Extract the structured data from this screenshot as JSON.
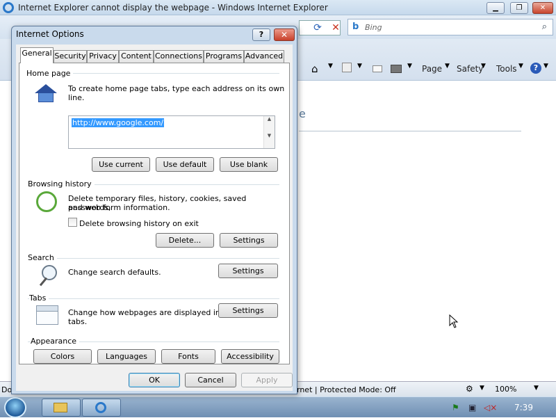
{
  "ie": {
    "title": "Internet Explorer cannot display the webpage - Windows Internet Explorer",
    "window_buttons": {
      "minimize": "▁",
      "maximize": "❐",
      "close": "✕"
    },
    "search_placeholder": "Bing",
    "commands": [
      "Page",
      "Safety",
      "Tools"
    ],
    "error_fragment": "e",
    "status_left": "Do",
    "status_text": "rnet | Protected Mode: Off",
    "zoom": "100%"
  },
  "taskbar": {
    "clock": "7:39"
  },
  "dialog": {
    "title": "Internet Options",
    "help": "?",
    "close": "✕",
    "tabs": [
      "General",
      "Security",
      "Privacy",
      "Content",
      "Connections",
      "Programs",
      "Advanced"
    ],
    "active_tab": "General",
    "home_page": {
      "label": "Home page",
      "description": "To create home page tabs, type each address on its own line.",
      "url": "http://www.google.com/",
      "buttons": [
        "Use current",
        "Use default",
        "Use blank"
      ]
    },
    "browsing_history": {
      "label": "Browsing history",
      "description_line1": "Delete temporary files, history, cookies, saved passwords,",
      "description_line2": "and web form information.",
      "checkbox_label": "Delete browsing history on exit",
      "delete_button": "Delete...",
      "settings_button": "Settings"
    },
    "search": {
      "label": "Search",
      "description": "Change search defaults.",
      "settings_button": "Settings"
    },
    "tabs_section": {
      "label": "Tabs",
      "description_line1": "Change how webpages are displayed in",
      "description_line2": "tabs.",
      "settings_button": "Settings"
    },
    "appearance": {
      "label": "Appearance",
      "buttons": [
        "Colors",
        "Languages",
        "Fonts",
        "Accessibility"
      ]
    },
    "footer": {
      "ok": "OK",
      "cancel": "Cancel",
      "apply": "Apply"
    }
  }
}
